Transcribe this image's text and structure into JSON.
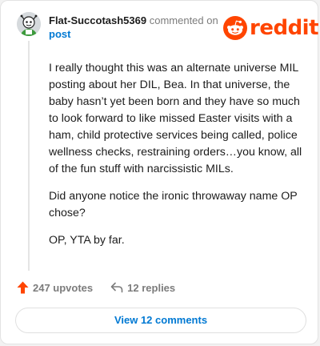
{
  "comment": {
    "username": "Flat-Succotash5369",
    "action_text": " commented on",
    "post_link": "post",
    "paragraphs": [
      "I really thought this was an alternate universe MIL posting about her DIL, Bea. In that universe, the baby hasn’t yet been born and they have so much to look forward to like missed Easter visits with a ham, child protective services being called, police wellness checks, restraining orders…you know, all of the fun stuff with narcissistic MILs.",
      "Did anyone notice the ironic throwaway name OP chose?",
      "OP, YTA by far."
    ]
  },
  "brand": {
    "name": "reddit",
    "color": "#ff4500",
    "icon": "snoo-icon"
  },
  "actions": {
    "upvotes": "247 upvotes",
    "replies": "12 replies",
    "upvote_icon": "upvote-arrow-icon",
    "reply_icon": "reply-icon",
    "upvote_color": "#ff4500"
  },
  "footer": {
    "view_comments": "View 12 comments",
    "link_color": "#0079d3"
  }
}
